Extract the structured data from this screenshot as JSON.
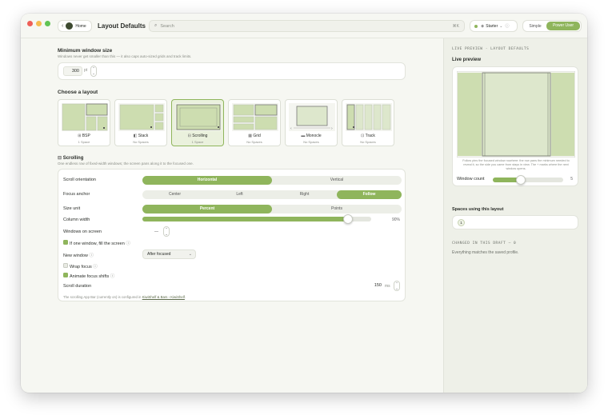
{
  "toolbar": {
    "back_label": "Home",
    "title": "Layout Defaults",
    "search_placeholder": "Search",
    "search_shortcut": "⌘K",
    "profile_label": "Starter",
    "mode_simple": "Simple",
    "mode_power": "Power User"
  },
  "minsize": {
    "heading": "Minimum window size",
    "subtitle": "Windows never get smaller than this — it also caps auto-sized grids and track limits.",
    "value": "300",
    "unit": "pt"
  },
  "layouts": {
    "heading": "Choose a layout",
    "items": [
      {
        "name": "BSP",
        "sub": "1 Space"
      },
      {
        "name": "Stack",
        "sub": "No Spaces"
      },
      {
        "name": "Scrolling",
        "sub": "1 Space"
      },
      {
        "name": "Grid",
        "sub": "No Spaces"
      },
      {
        "name": "Monocle",
        "sub": "No Spaces"
      },
      {
        "name": "Track",
        "sub": "No Spaces"
      }
    ]
  },
  "scrolling": {
    "heading": "Scrolling",
    "subtitle": "One endless row of fixed-width windows; the screen pans along it to the focused one.",
    "orientation_label": "Scroll orientation",
    "orientation_options": [
      "Horizontal",
      "Vertical"
    ],
    "focus_anchor_label": "Focus anchor",
    "focus_anchor_options": [
      "Center",
      "Left",
      "Right",
      "Follow"
    ],
    "size_unit_label": "Size unit",
    "size_unit_options": [
      "Percent",
      "Points"
    ],
    "column_width_label": "Column width",
    "column_width_value": "90%",
    "column_width_fraction": 0.9,
    "windows_on_screen_label": "Windows on screen",
    "windows_on_screen_value": "—",
    "fill_label": "If one window, fill the screen",
    "new_window_label": "New window",
    "new_window_value": "After focused",
    "wrap_focus_label": "Wrap focus",
    "animate_label": "Animate focus shifts",
    "scroll_duration_label": "Scroll duration",
    "scroll_duration_value": "150",
    "scroll_duration_unit": "ms",
    "footnote_prefix": "The scrolling App Bar (currently on) is configured in",
    "footnote_link": "KiwiShelf & Bars › KiwiShelf",
    "footnote_suffix": "."
  },
  "sidebar": {
    "caption": "LIVE PREVIEW · LAYOUT DEFAULTS",
    "preview_heading": "Live preview",
    "preview_desc": "Follow pins the focused window nowhere: the row pans the minimum needed to reveal it, so the side you came from stays in view. The + marks where the next window opens.",
    "window_count_label": "Window count",
    "window_count_value": "5",
    "window_count_fraction": 0.4,
    "spaces_heading": "Spaces using this layout",
    "spaces_badge": "1",
    "changed_caption": "CHANGED IN THIS DRAFT — 0",
    "changed_text": "Everything matches the saved profile."
  },
  "colors": {
    "accent": "#8fb55c",
    "window_bg": "#f6f7f2",
    "sidebar_bg": "#eef0e8"
  }
}
